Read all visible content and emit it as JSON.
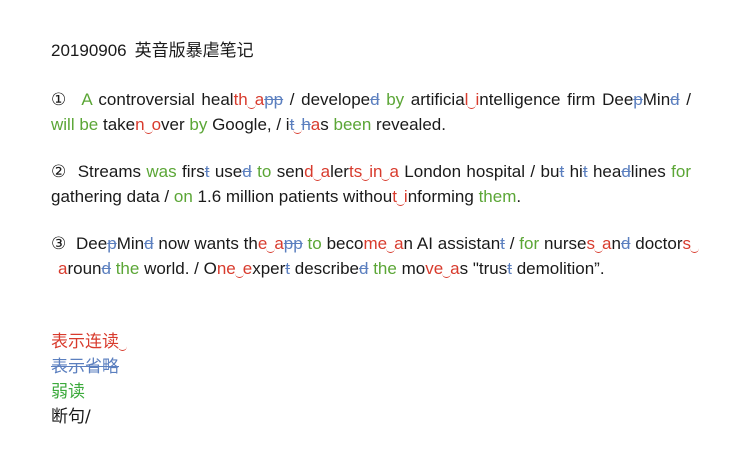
{
  "title": {
    "date": "20190906",
    "subtitle": "英音版暴虐笔记"
  },
  "paragraphs": {
    "p1": {
      "marker": "①"
    },
    "p2": {
      "marker": "②"
    },
    "p3": {
      "marker": "③"
    }
  },
  "legend": {
    "linking": "表示连读",
    "omission": "表示省略",
    "weak": "弱读",
    "pause": "断句/"
  },
  "colors": {
    "linking": "#d83b2d",
    "omission": "#5b7fbf",
    "weak": "#5ba636",
    "plain": "#1a1a1a"
  }
}
